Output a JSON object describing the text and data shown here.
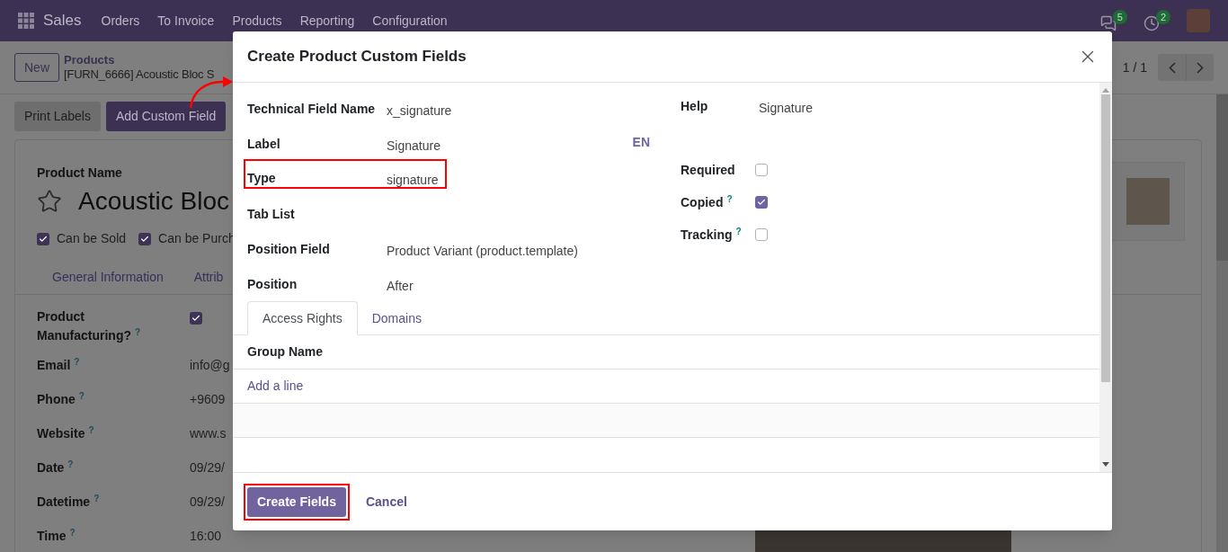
{
  "navbar": {
    "app_name": "Sales",
    "menu": [
      "Orders",
      "To Invoice",
      "Products",
      "Reporting",
      "Configuration"
    ],
    "messages_count": "5",
    "activities_count": "2"
  },
  "control_panel": {
    "new_button": "New",
    "breadcrumb_parent": "Products",
    "breadcrumb_current": "[FURN_6666] Acoustic Bloc S",
    "pager": "1 / 1"
  },
  "actions": [
    {
      "label": "Print Labels",
      "kind": "secondary"
    },
    {
      "label": "Add Custom Field",
      "kind": "primary"
    }
  ],
  "product": {
    "name_label": "Product Name",
    "name": "Acoustic Bloc",
    "checkboxes": [
      {
        "label": "Can be Sold",
        "checked": true
      },
      {
        "label": "Can be Purch",
        "checked": true
      }
    ],
    "tabs": [
      "General Information",
      "Attrib"
    ],
    "fields": [
      {
        "label": "Product Manufacturing?",
        "tooltip": "?",
        "kind": "checkbox",
        "checked": true
      },
      {
        "label": "Email",
        "tooltip": "?",
        "kind": "text",
        "value": "info@g"
      },
      {
        "label": "Phone",
        "tooltip": "?",
        "kind": "text",
        "value": "+9609"
      },
      {
        "label": "Website",
        "tooltip": "?",
        "kind": "text",
        "value": "www.s"
      },
      {
        "label": "Date",
        "tooltip": "?",
        "kind": "text",
        "value": "09/29/"
      },
      {
        "label": "Datetime",
        "tooltip": "?",
        "kind": "text",
        "value": "09/29/"
      },
      {
        "label": "Time",
        "tooltip": "?",
        "kind": "text",
        "value": "16:00"
      }
    ]
  },
  "dialog": {
    "title": "Create Product Custom Fields",
    "fields": [
      {
        "label": "Technical Field Name",
        "value": "x_signature",
        "annotated": false
      },
      {
        "label": "Label",
        "value": "Signature",
        "lang": "EN",
        "annotated": false
      },
      {
        "label": "Type",
        "value": "signature",
        "annotated": true
      },
      {
        "label": "Tab List",
        "annotated": false
      },
      {
        "label": "Position Field",
        "value": "Product Variant (product.template)",
        "annotated": false
      },
      {
        "label": "Position",
        "value": "After",
        "annotated": false
      }
    ],
    "help": {
      "label": "Help",
      "value": "Signature"
    },
    "options": [
      {
        "label": "Required",
        "checked": false
      },
      {
        "label": "Copied",
        "tooltip": "?",
        "checked": true
      },
      {
        "label": "Tracking",
        "tooltip": "?",
        "checked": false
      }
    ],
    "tabs": [
      {
        "label": "Access Rights",
        "selected": true
      },
      {
        "label": "Domains",
        "selected": false
      }
    ],
    "table": {
      "column": "Group Name",
      "add_line": "Add a line"
    },
    "buttons": [
      {
        "label": "Create Fields",
        "kind": "primary",
        "annotated": true
      },
      {
        "label": "Cancel",
        "kind": "link",
        "annotated": false
      }
    ]
  }
}
